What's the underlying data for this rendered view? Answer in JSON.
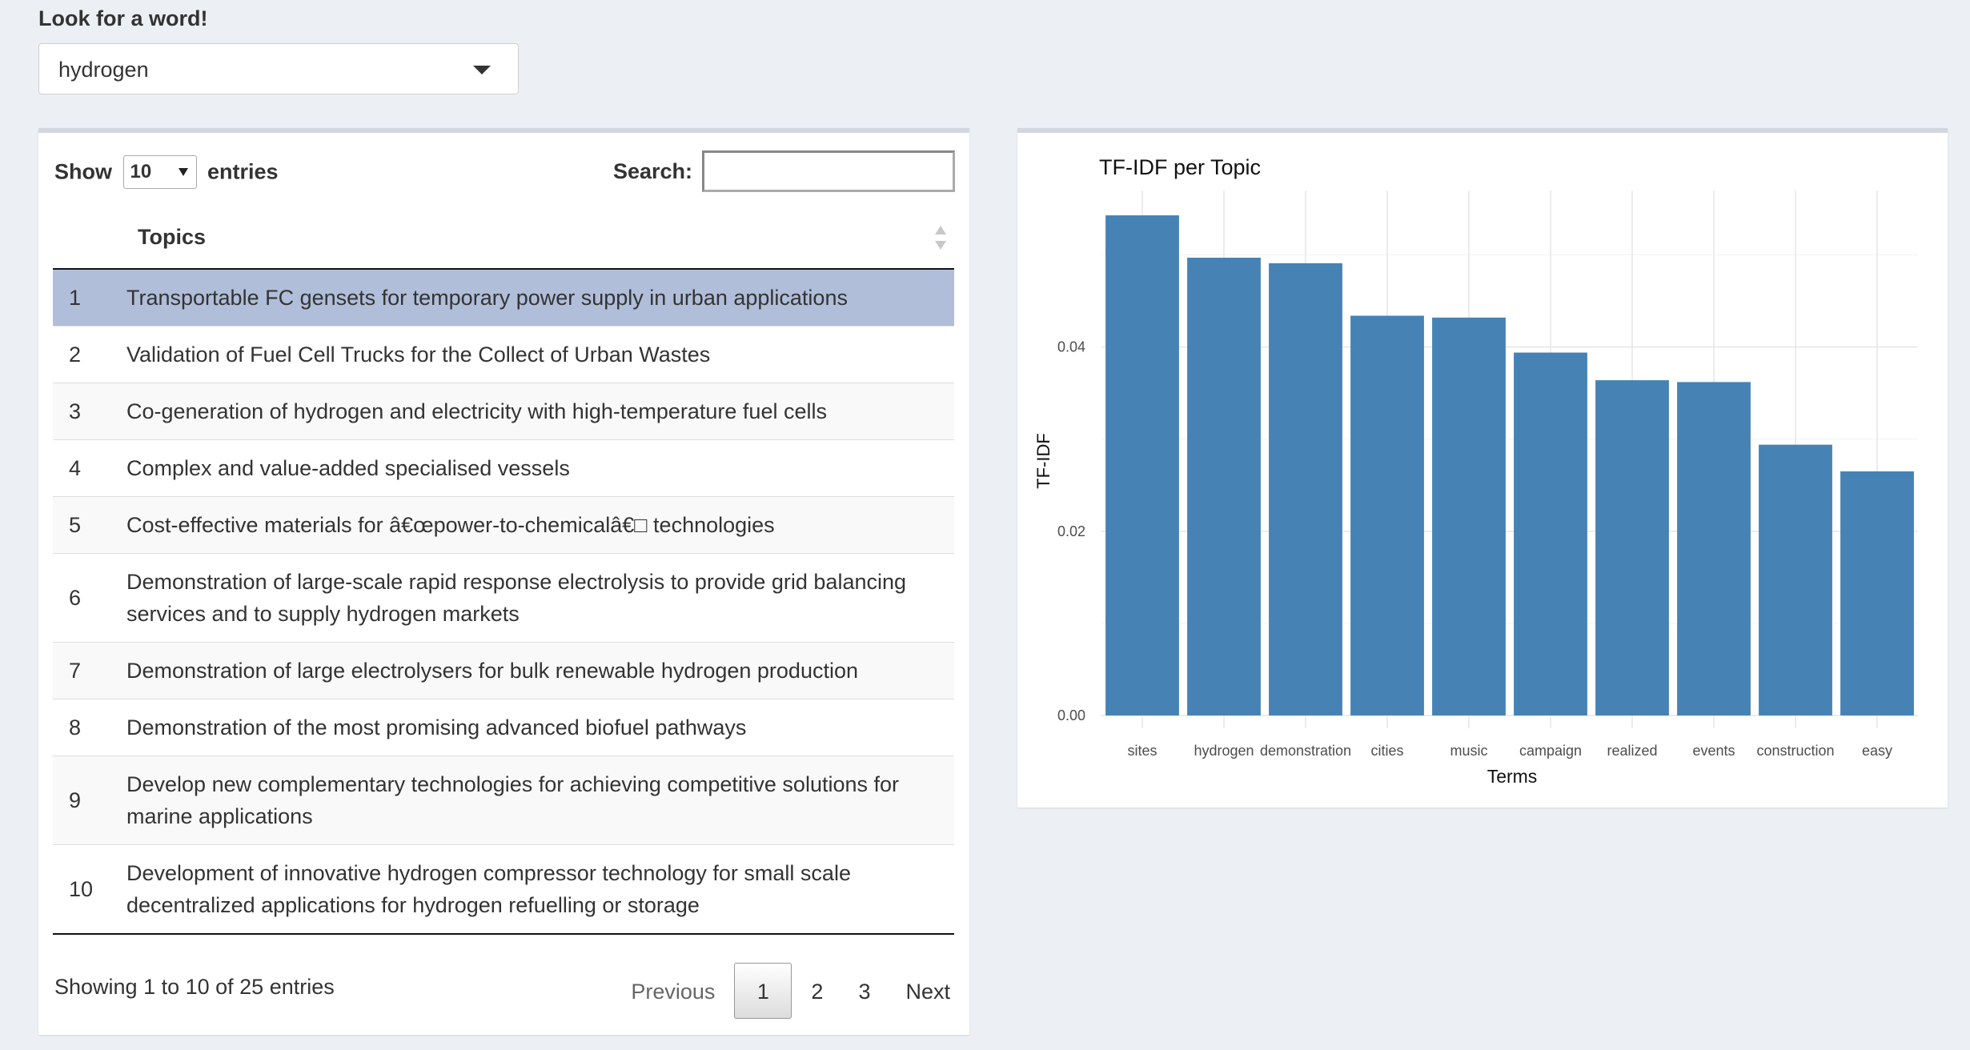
{
  "word_picker": {
    "label": "Look for a word!",
    "selected": "hydrogen"
  },
  "table": {
    "length_prefix": "Show",
    "length_value": "10",
    "length_suffix": "entries",
    "search_label": "Search:",
    "search_value": "",
    "column_header": "Topics",
    "rows": [
      {
        "index": "1",
        "topic": "Transportable FC gensets for temporary power supply in urban applications",
        "selected": true
      },
      {
        "index": "2",
        "topic": "Validation of Fuel Cell Trucks for the Collect of Urban Wastes"
      },
      {
        "index": "3",
        "topic": "Co-generation of hydrogen and electricity with high-temperature fuel cells"
      },
      {
        "index": "4",
        "topic": "Complex and value-added specialised vessels"
      },
      {
        "index": "5",
        "topic": "Cost-effective materials for â€œpower-to-chemicalâ€□ technologies"
      },
      {
        "index": "6",
        "topic": "Demonstration of large-scale rapid response electrolysis to provide grid balancing services and to supply hydrogen markets"
      },
      {
        "index": "7",
        "topic": "Demonstration of large electrolysers for bulk renewable hydrogen production"
      },
      {
        "index": "8",
        "topic": "Demonstration of the most promising advanced biofuel pathways"
      },
      {
        "index": "9",
        "topic": "Develop new complementary technologies for achieving competitive solutions for marine applications"
      },
      {
        "index": "10",
        "topic": "Development of innovative hydrogen compressor technology for small scale decentralized applications for hydrogen refuelling or storage"
      }
    ],
    "info": "Showing 1 to 10 of 25 entries",
    "pagination": {
      "previous": "Previous",
      "pages": [
        "1",
        "2",
        "3"
      ],
      "current": "1",
      "next": "Next"
    }
  },
  "chart_data": {
    "type": "bar",
    "title": "TF-IDF per Topic",
    "xlabel": "Terms",
    "ylabel": "TF-IDF",
    "categories": [
      "sites",
      "hydrogen",
      "demonstration",
      "cities",
      "music",
      "campaign",
      "realized",
      "events",
      "construction",
      "easy"
    ],
    "values": [
      0.0543,
      0.0497,
      0.0491,
      0.0434,
      0.0432,
      0.0394,
      0.0364,
      0.0362,
      0.0294,
      0.0265
    ],
    "ylim": [
      0,
      0.057
    ],
    "yticks": [
      "0.00",
      "0.02",
      "0.04"
    ],
    "ytick_values": [
      0,
      0.02,
      0.04
    ],
    "bar_color": "#4682b4",
    "grid": true
  },
  "colors": {
    "background": "#ecf0f5",
    "selected_row": "#b0bed9",
    "bar": "#4682b4"
  }
}
